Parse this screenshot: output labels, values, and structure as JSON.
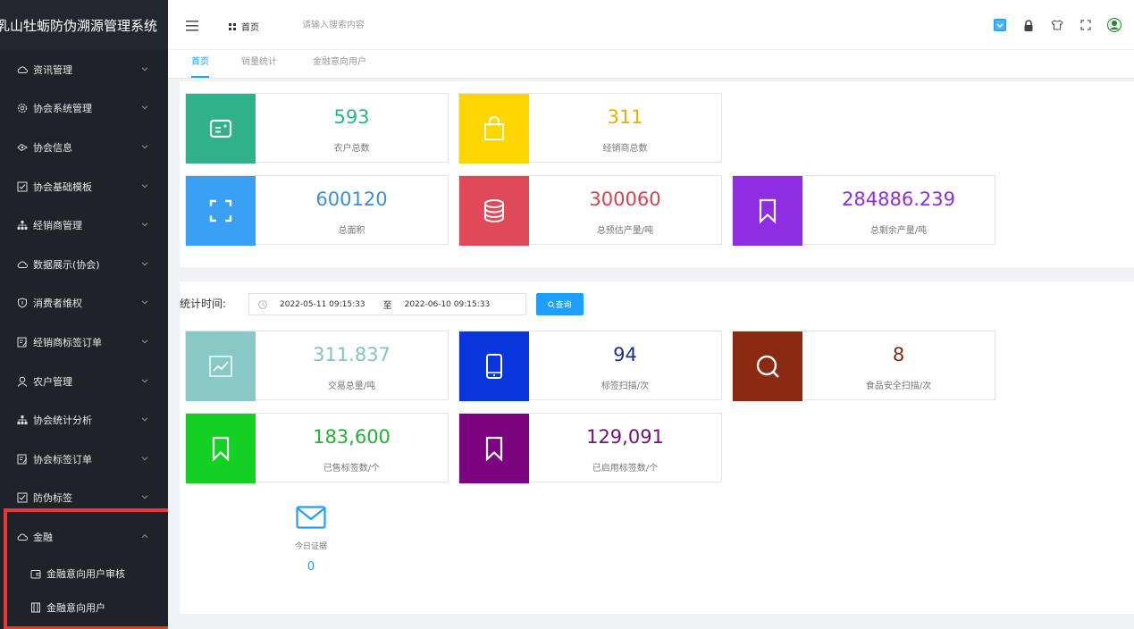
{
  "app": {
    "title": "乳山牡蛎防伪溯源管理系统"
  },
  "sidebar": {
    "items": [
      {
        "label": "资讯管理",
        "icon": "cloud-icon"
      },
      {
        "label": "协会系统管理",
        "icon": "gear-icon"
      },
      {
        "label": "协会信息",
        "icon": "eye-icon"
      },
      {
        "label": "协会基础模板",
        "icon": "checkbox-icon"
      },
      {
        "label": "经销商管理",
        "icon": "org-icon"
      },
      {
        "label": "数据展示(协会)",
        "icon": "cloud-icon"
      },
      {
        "label": "消费者维权",
        "icon": "shield-icon"
      },
      {
        "label": "经销商标签订单",
        "icon": "edit-icon"
      },
      {
        "label": "农户管理",
        "icon": "user-icon"
      },
      {
        "label": "协会统计分析",
        "icon": "org-icon"
      },
      {
        "label": "协会标签订单",
        "icon": "edit-icon"
      },
      {
        "label": "防伪标签",
        "icon": "checkbox-icon"
      },
      {
        "label": "金融",
        "icon": "cloud-icon"
      }
    ],
    "sub_items": [
      {
        "label": "金融意向用户审核",
        "icon": "wallet-icon"
      },
      {
        "label": "金融意向用户",
        "icon": "book-icon"
      }
    ]
  },
  "header": {
    "home_label": "首页",
    "search_placeholder": "请输入搜索内容"
  },
  "tabs": [
    {
      "label": "首页",
      "active": true
    },
    {
      "label": "销量统计",
      "active": false
    },
    {
      "label": "金融意向用户",
      "active": false
    }
  ],
  "stats_top": [
    {
      "value": "593",
      "label": "农户总数",
      "color": "#2fb28a",
      "value_color": "#2fb28a",
      "icon": "id-card-icon"
    },
    {
      "value": "311",
      "label": "经销商总数",
      "color": "#ffd600",
      "value_color": "#e0b400",
      "icon": "shopping-bag-icon"
    },
    {
      "value": "600120",
      "label": "总面积",
      "color": "#3aa0f3",
      "value_color": "#3a8fd8",
      "icon": "area-frame-icon"
    },
    {
      "value": "300060",
      "label": "总预估产量/吨",
      "color": "#e04a58",
      "value_color": "#d0454f",
      "icon": "database-icon"
    },
    {
      "value": "284886.239",
      "label": "总剩余产量/吨",
      "color": "#8e2de2",
      "value_color": "#8e2de2",
      "icon": "bookmark-icon"
    }
  ],
  "filter": {
    "label": "统计时间:",
    "start": "2022-05-11 09:15:33",
    "separator": "至",
    "end": "2022-06-10 09:15:33",
    "button": "查询"
  },
  "stats_bottom": [
    {
      "value": "311.837",
      "label": "交易总量/吨",
      "color": "#88c9c5",
      "value_color": "#80c4bf",
      "icon": "trend-chart-icon"
    },
    {
      "value": "94",
      "label": "标签扫描/次",
      "color": "#0a35dc",
      "value_color": "#1a2f96",
      "icon": "mobile-icon"
    },
    {
      "value": "8",
      "label": "食品安全扫描/次",
      "color": "#8b2a12",
      "value_color": "#7a2a14",
      "icon": "search-icon"
    },
    {
      "value": "183,600",
      "label": "已售标签数/个",
      "color": "#14d024",
      "value_color": "#22b33a",
      "icon": "bookmark-icon"
    },
    {
      "value": "129,091",
      "label": "已启用标签数/个",
      "color": "#7a057f",
      "value_color": "#6d1477",
      "icon": "bookmark-icon"
    }
  ],
  "today": {
    "label": "今日证据",
    "value": "0",
    "icon": "mail-icon"
  }
}
